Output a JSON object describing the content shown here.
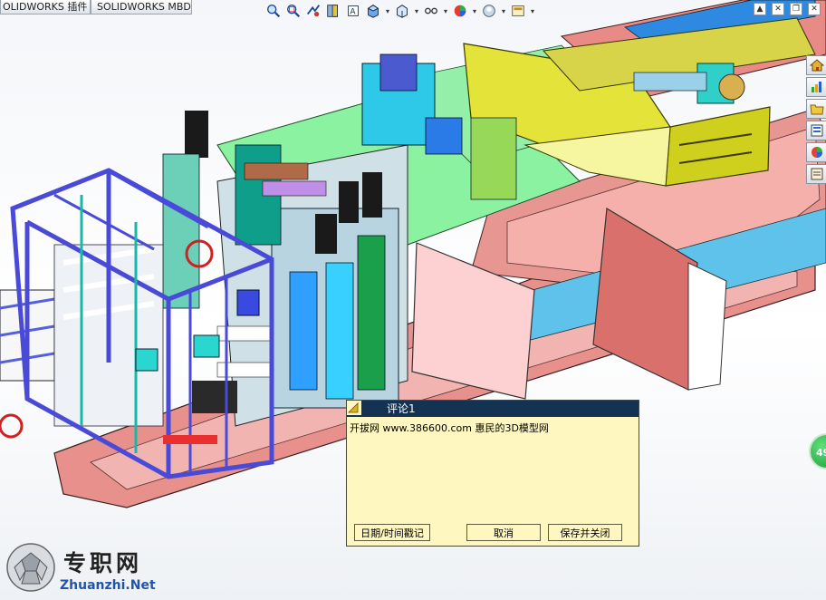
{
  "tabs": [
    {
      "label": "OLIDWORKS 插件"
    },
    {
      "label": "SOLIDWORKS MBD"
    }
  ],
  "toolbar": {
    "buttons": [
      {
        "icon": "zoom-to-fit-icon",
        "caret": false
      },
      {
        "icon": "zoom-to-area-icon",
        "caret": false
      },
      {
        "icon": "previous-view-icon",
        "caret": false
      },
      {
        "icon": "section-view-icon",
        "caret": false
      },
      {
        "icon": "dynamic-annotation-icon",
        "caret": false
      },
      {
        "icon": "view-orientation-icon",
        "caret": true
      },
      {
        "icon": "display-style-icon",
        "caret": true
      },
      {
        "icon": "hide-show-items-icon",
        "caret": true
      },
      {
        "icon": "edit-appearance-icon",
        "caret": true
      },
      {
        "icon": "apply-scene-icon",
        "caret": true
      },
      {
        "icon": "view-settings-icon",
        "caret": true
      }
    ]
  },
  "window_controls": [
    "restore-up-icon",
    "close-small-icon",
    "restore-icon",
    "close-icon"
  ],
  "task_pane": [
    "home-icon",
    "design-library-icon",
    "file-explorer-icon",
    "view-palette-icon",
    "appearances-icon",
    "custom-properties-icon"
  ],
  "comment": {
    "title": "评论1",
    "text": "开拔网 www.386600.com 惠民的3D模型网",
    "buttons": {
      "timestamp": "日期/时间戳记",
      "cancel": "取消",
      "save_close": "保存并关闭"
    }
  },
  "counter_badge": "49",
  "watermark": {
    "cn": "专职网",
    "en": "Zhuanzhi.Net"
  },
  "colors": {
    "frame_blue": "#5c5ef0",
    "frame_pink": "#e88a86",
    "plate_green": "#8af2a0",
    "hopper_yellow": "#dede2a",
    "cyan": "#3fd7e8",
    "comment_bg": "#fff7bf",
    "comment_title": "#143252"
  }
}
